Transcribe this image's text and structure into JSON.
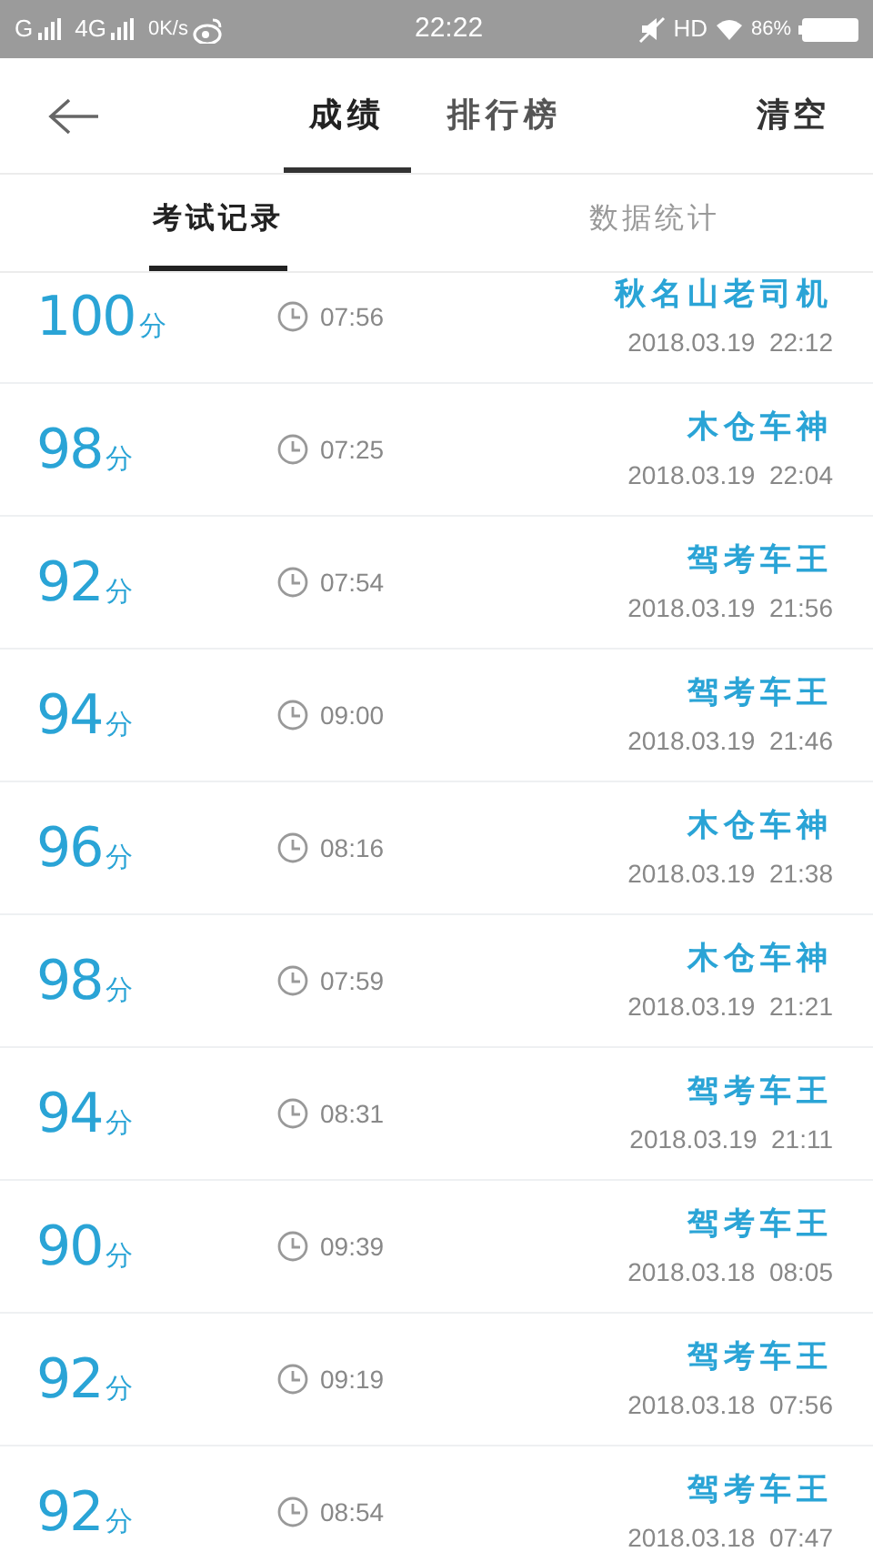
{
  "status_bar": {
    "carrier_1": "G",
    "carrier_2": "4G",
    "speed": "0K/s",
    "time": "22:22",
    "network": "HD",
    "battery": "86%"
  },
  "header": {
    "tabs": [
      {
        "label": "成绩",
        "selected": true
      },
      {
        "label": "排行榜",
        "selected": false
      }
    ],
    "action": "清空"
  },
  "sub_tabs": [
    {
      "label": "考试记录",
      "selected": true
    },
    {
      "label": "数据统计",
      "selected": false
    }
  ],
  "records": [
    {
      "score": "100",
      "unit": "分",
      "duration": "07:56",
      "name": "秋名山老司机",
      "date": "2018.03.19  22:12"
    },
    {
      "score": "98",
      "unit": "分",
      "duration": "07:25",
      "name": "木仓车神",
      "date": "2018.03.19  22:04"
    },
    {
      "score": "92",
      "unit": "分",
      "duration": "07:54",
      "name": "驾考车王",
      "date": "2018.03.19  21:56"
    },
    {
      "score": "94",
      "unit": "分",
      "duration": "09:00",
      "name": "驾考车王",
      "date": "2018.03.19  21:46"
    },
    {
      "score": "96",
      "unit": "分",
      "duration": "08:16",
      "name": "木仓车神",
      "date": "2018.03.19  21:38"
    },
    {
      "score": "98",
      "unit": "分",
      "duration": "07:59",
      "name": "木仓车神",
      "date": "2018.03.19  21:21"
    },
    {
      "score": "94",
      "unit": "分",
      "duration": "08:31",
      "name": "驾考车王",
      "date": "2018.03.19  21:11"
    },
    {
      "score": "90",
      "unit": "分",
      "duration": "09:39",
      "name": "驾考车王",
      "date": "2018.03.18  08:05"
    },
    {
      "score": "92",
      "unit": "分",
      "duration": "09:19",
      "name": "驾考车王",
      "date": "2018.03.18  07:56"
    },
    {
      "score": "92",
      "unit": "分",
      "duration": "08:54",
      "name": "驾考车王",
      "date": "2018.03.18  07:47"
    }
  ]
}
